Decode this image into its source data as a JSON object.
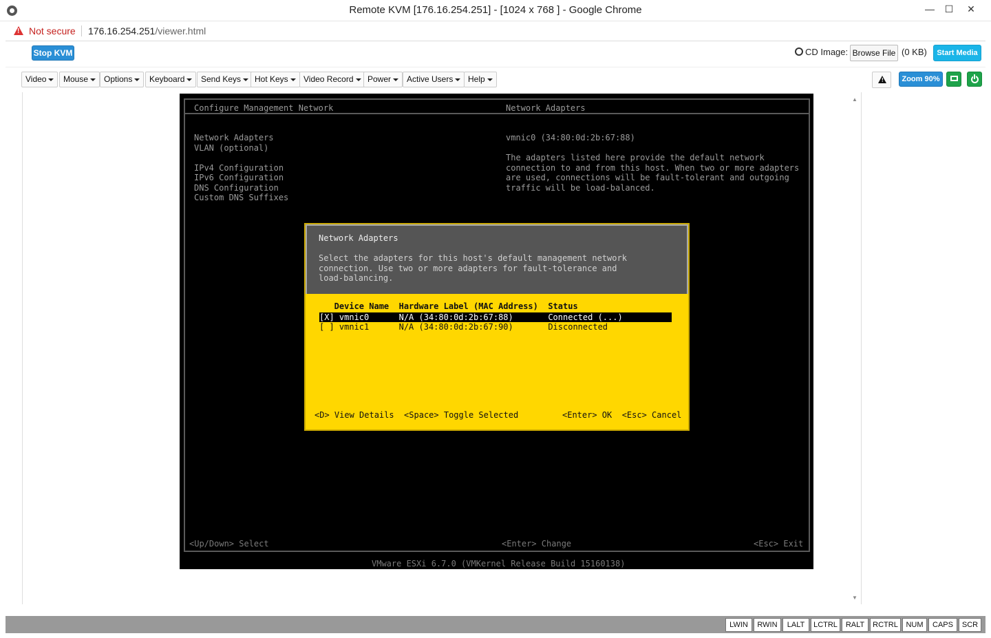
{
  "window": {
    "title": "Remote KVM [176.16.254.251] - [1024 x 768 ] - Google Chrome",
    "minimize": "—",
    "maximize": "☐",
    "close": "✕"
  },
  "address": {
    "security_label": "Not secure",
    "host": "176.16.254.251",
    "path": "/viewer.html"
  },
  "kvm_toolbar": {
    "stop_kvm": "Stop KVM",
    "cd_image_label": "CD Image:",
    "browse_file": "Browse File",
    "file_size": "(0 KB)",
    "start_media": "Start Media"
  },
  "menus": [
    "Video",
    "Mouse",
    "Options",
    "Keyboard",
    "Send Keys",
    "Hot Keys",
    "Video Record",
    "Power",
    "Active Users",
    "Help"
  ],
  "zoom_label": "Zoom 90%",
  "screen": {
    "left_header": "Configure Management Network",
    "right_header": "Network Adapters",
    "left_items": [
      "Network Adapters",
      "VLAN (optional)",
      "",
      "IPv4 Configuration",
      "IPv6 Configuration",
      "DNS Configuration",
      "Custom DNS Suffixes"
    ],
    "right_nic": "vmnic0 (34:80:0d:2b:67:88)",
    "right_desc": [
      "The adapters listed here provide the default network",
      "connection to and from this host. When two or more adapters",
      "are used, connections will be fault-tolerant and outgoing",
      "traffic will be load-balanced."
    ],
    "dialog": {
      "title": "Network Adapters",
      "description": [
        "Select the adapters for this host's default management network",
        "connection. Use two or more adapters for fault-tolerance and",
        "load-balancing."
      ],
      "columns_header": "   Device Name  Hardware Label (MAC Address)  Status",
      "rows": [
        "[X] vmnic0      N/A (34:80:0d:2b:67:88)       Connected (...)",
        "[ ] vmnic1      N/A (34:80:0d:2b:67:90)       Disconnected"
      ],
      "footer_left": "<D> View Details  <Space> Toggle Selected",
      "footer_right": "<Enter> OK  <Esc> Cancel"
    },
    "footer_left": "<Up/Down> Select",
    "footer_center": "<Enter> Change",
    "footer_right": "<Esc> Exit",
    "build": "VMware ESXi 6.7.0 (VMKernel Release Build 15160138)"
  },
  "keys": [
    "LWIN",
    "RWIN",
    "LALT",
    "LCTRL",
    "RALT",
    "RCTRL",
    "NUM",
    "CAPS",
    "SCR"
  ]
}
